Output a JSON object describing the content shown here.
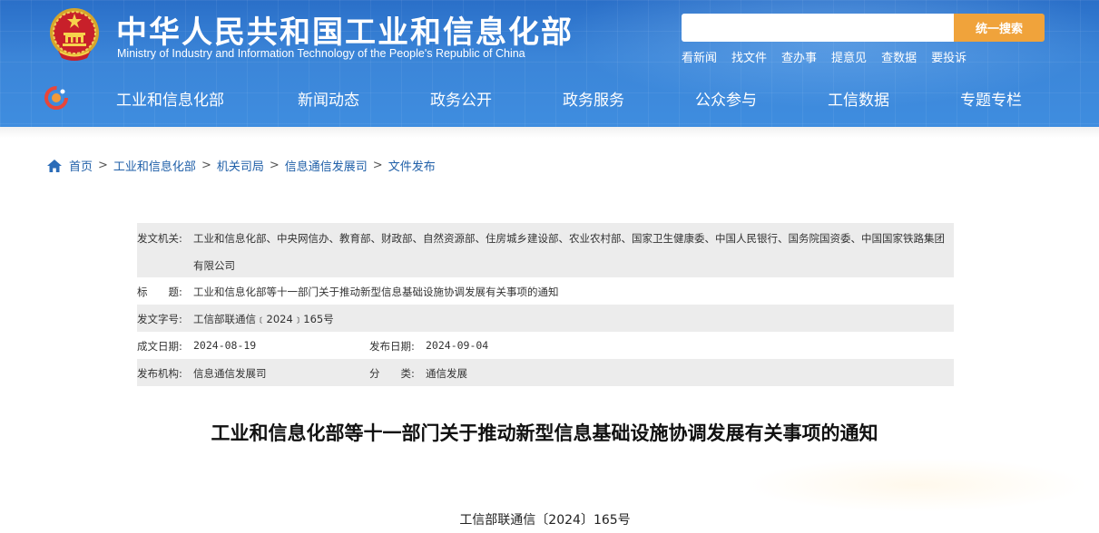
{
  "header": {
    "title": "中华人民共和国工业和信息化部",
    "subtitle": "Ministry of Industry and Information Technology of the People's Republic of China",
    "search": {
      "placeholder": "",
      "button_label": "统一搜索"
    },
    "quick_links": [
      "看新闻",
      "找文件",
      "查办事",
      "提意见",
      "查数据",
      "要投诉"
    ],
    "nav": [
      "工业和信息化部",
      "新闻动态",
      "政务公开",
      "政务服务",
      "公众参与",
      "工信数据",
      "专题专栏"
    ]
  },
  "breadcrumb": [
    "首页",
    "工业和信息化部",
    "机关司局",
    "信息通信发展司",
    "文件发布"
  ],
  "info": {
    "issuer_label": "发文机关:",
    "issuer_value": "工业和信息化部、中央网信办、教育部、财政部、自然资源部、住房城乡建设部、农业农村部、国家卫生健康委、中国人民银行、国务院国资委、中国国家铁路集团有限公司",
    "title_label": "标　　题:",
    "title_value": "工业和信息化部等十一部门关于推动新型信息基础设施协调发展有关事项的通知",
    "docno_label": "发文字号:",
    "docno_value": "工信部联通信﹝2024﹞165号",
    "created_label": "成文日期:",
    "created_value": "2024-08-19",
    "published_label": "发布日期:",
    "published_value": "2024-09-04",
    "org_label": "发布机构:",
    "org_value": "信息通信发展司",
    "category_label": "分　　类:",
    "category_value": "通信发展"
  },
  "article": {
    "title": "工业和信息化部等十一部门关于推动新型信息基础设施协调发展有关事项的通知",
    "doc_number": "工信部联通信〔2024〕165号"
  },
  "colors": {
    "header_blue": "#3b85d8",
    "search_button": "#f0a33b",
    "breadcrumb_link": "#1f5fa8",
    "table_shade": "#ececec"
  }
}
